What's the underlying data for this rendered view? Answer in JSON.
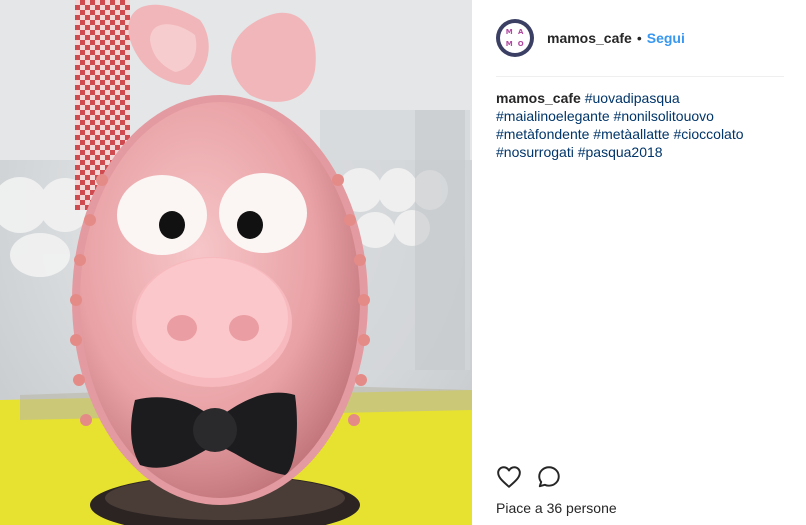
{
  "post": {
    "username": "mamos_cafe",
    "separator": "•",
    "follow_label": "Segui",
    "avatar_letters": [
      "M",
      "A",
      "M",
      "O"
    ],
    "caption_author": "mamos_cafe",
    "hashtags": [
      "#uovadipasqua",
      "#maialinoelegante",
      "#nonilsolitouovo",
      "#metàfondente",
      "#metàallatte",
      "#cioccolato",
      "#nosurrogati",
      "#pasqua2018"
    ],
    "likes_text": "Piace a 36 persone"
  },
  "icons": {
    "like": "heart-icon",
    "comment": "comment-icon"
  },
  "colors": {
    "link_blue": "#3897f0",
    "hashtag": "#003569",
    "text": "#262626"
  }
}
